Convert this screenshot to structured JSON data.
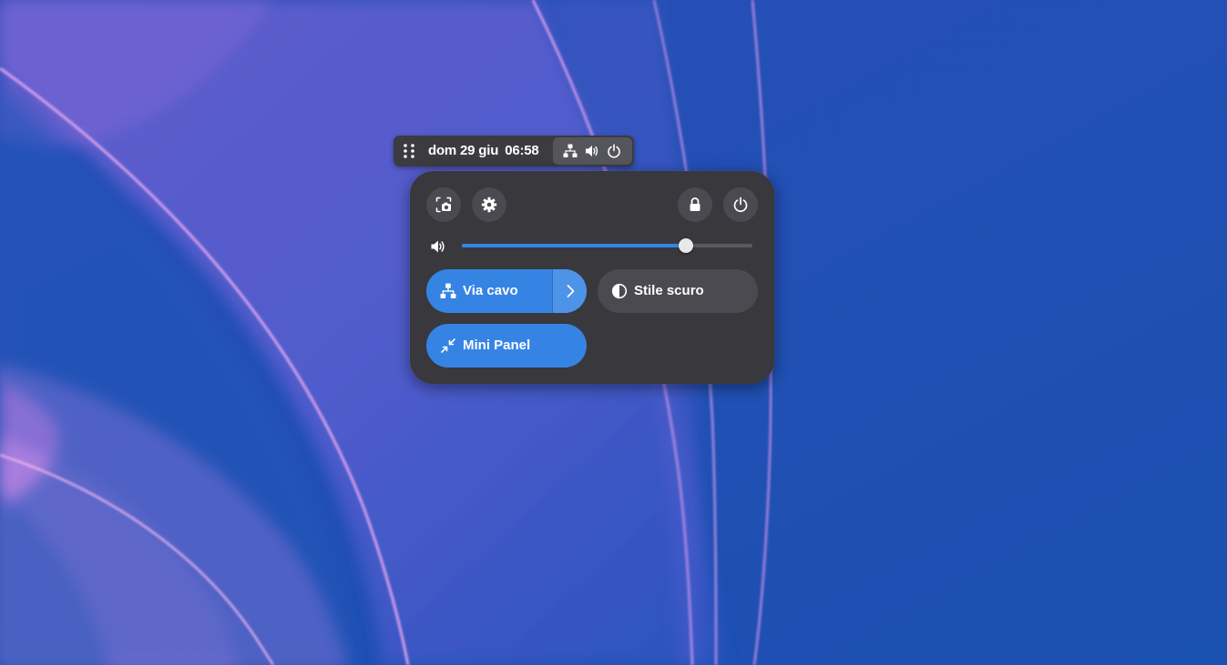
{
  "topbar": {
    "date": "dom 29 giu",
    "time": "06:58",
    "icons": [
      "drag-handle-icon",
      "network-wired-icon",
      "volume-icon",
      "power-icon"
    ]
  },
  "quick_settings": {
    "buttons": [
      "screenshot-icon",
      "settings-icon",
      "lock-icon",
      "power-icon"
    ],
    "volume": {
      "icon": "volume-icon",
      "level": 0.77
    },
    "toggles": [
      {
        "label": "Via cavo",
        "icon": "network-wired-icon",
        "active": true,
        "has_menu": true
      },
      {
        "label": "Stile scuro",
        "icon": "dark-mode-icon",
        "active": false,
        "has_menu": false
      },
      {
        "label": "Mini Panel",
        "icon": "minimize-icon",
        "active": true,
        "has_menu": false
      }
    ]
  },
  "colors": {
    "accent": "#3584e4",
    "panel_bg": "#38383d",
    "button_bg": "#4a4a50",
    "wallpaper_blue": "#1a4fb0",
    "wallpaper_purple": "#b97ad8"
  }
}
